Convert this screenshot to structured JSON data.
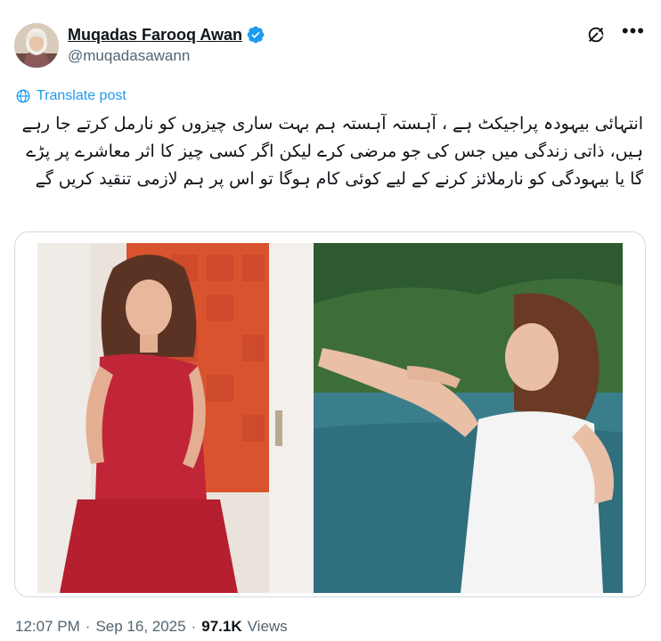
{
  "author": {
    "name": "Muqadas Farooq Awan",
    "handle": "@muqadasawann",
    "verified": true
  },
  "translate_label": "Translate post",
  "post_text": "انتہائی بیہودہ پراجیکٹ ہے ، آہستہ آہستہ ہم بہت ساری چیزوں کو نارمل کرتے جا رہے ہیں، ذاتی زندگی میں جس کی جو مرضی کرے لیکن اگر کسی چیز کا اثر معاشرے پر پڑے گا یا بیہودگی کو نارملائز کرنے کے لیے کوئی کام ہوگا تو اس پر ہم لازمی تنقید کریں گے",
  "meta": {
    "time": "12:07 PM",
    "separator": "·",
    "date": "Sep 16, 2025",
    "views_count": "97.1K",
    "views_label": "Views"
  },
  "icons": {
    "verified": "verified-badge-icon",
    "grok": "grok-icon",
    "more": "more-icon",
    "translate": "globe-icon"
  },
  "colors": {
    "accent": "#1d9bf0",
    "secondary_text": "#536471",
    "border": "#cfd9de"
  }
}
